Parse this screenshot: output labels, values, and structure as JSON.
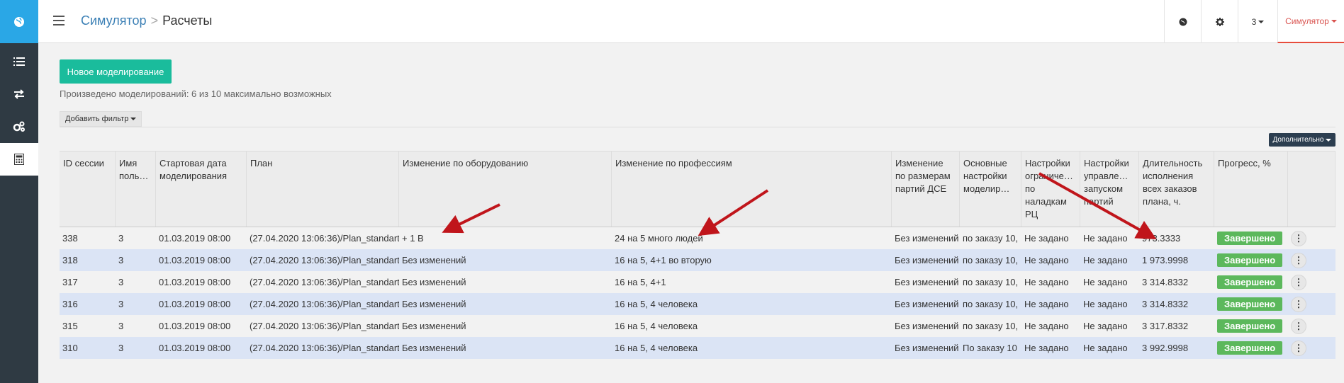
{
  "colors": {
    "sidebar": "#2f3a43",
    "accent": "#2aa7e6",
    "primary_btn": "#1abc9c",
    "success": "#5cb85c",
    "row_alt": "#dbe4f5",
    "annotation": "#c0151b"
  },
  "sidebar": {
    "items": [
      "globe-icon",
      "list-icon",
      "transfer-icon",
      "gears-icon",
      "calculator-icon"
    ]
  },
  "breadcrumb": {
    "parent": "Симулятор",
    "separator": ">",
    "current": "Расчеты"
  },
  "topbar": {
    "count": "3",
    "user": "Симулятор"
  },
  "toolbar": {
    "new_button": "Новое моделирование",
    "info": "Произведено моделирований: 6 из 10 максимально возможных",
    "filter_button": "Добавить фильтр",
    "more_button": "Дополнительно"
  },
  "table": {
    "headers": [
      "ID сессии",
      "Имя поль…",
      "Стартовая дата моделирования",
      "План",
      "Изменение по оборудованию",
      "Изменение по профессиям",
      "Изменение по размерам партий ДСЕ",
      "Основные настройки моделир…",
      "Настройки ограниче… по наладкам РЦ",
      "Настройки управле… запуском партий",
      "Длительность исполнения всех заказов плана, ч.",
      "Прогресс, %",
      ""
    ],
    "rows": [
      {
        "id": "338",
        "user": "3",
        "start": "01.03.2019 08:00",
        "plan": "(27.04.2020 13:06:36)/Plan_standart",
        "equip": "+ 1 В",
        "prof": "24 на 5 много людей",
        "batch": "Без изменений",
        "main": "по заказу 10,",
        "setup": "Не задано",
        "launch": "Не задано",
        "duration": "973.3333",
        "status": "Завершено"
      },
      {
        "id": "318",
        "user": "3",
        "start": "01.03.2019 08:00",
        "plan": "(27.04.2020 13:06:36)/Plan_standart",
        "equip": "Без изменений",
        "prof": "16 на 5, 4+1 во вторую",
        "batch": "Без изменений",
        "main": "по заказу 10,",
        "setup": "Не задано",
        "launch": "Не задано",
        "duration": "1 973.9998",
        "status": "Завершено"
      },
      {
        "id": "317",
        "user": "3",
        "start": "01.03.2019 08:00",
        "plan": "(27.04.2020 13:06:36)/Plan_standart",
        "equip": "Без изменений",
        "prof": "16 на 5, 4+1",
        "batch": "Без изменений",
        "main": "по заказу 10,",
        "setup": "Не задано",
        "launch": "Не задано",
        "duration": "3 314.8332",
        "status": "Завершено"
      },
      {
        "id": "316",
        "user": "3",
        "start": "01.03.2019 08:00",
        "plan": "(27.04.2020 13:06:36)/Plan_standart",
        "equip": "Без изменений",
        "prof": "16 на 5, 4 человека",
        "batch": "Без изменений",
        "main": "по заказу 10,",
        "setup": "Не задано",
        "launch": "Не задано",
        "duration": "3 314.8332",
        "status": "Завершено"
      },
      {
        "id": "315",
        "user": "3",
        "start": "01.03.2019 08:00",
        "plan": "(27.04.2020 13:06:36)/Plan_standart",
        "equip": "Без изменений",
        "prof": "16 на 5, 4 человека",
        "batch": "Без изменений",
        "main": "по заказу 10,",
        "setup": "Не задано",
        "launch": "Не задано",
        "duration": "3 317.8332",
        "status": "Завершено"
      },
      {
        "id": "310",
        "user": "3",
        "start": "01.03.2019 08:00",
        "plan": "(27.04.2020 13:06:36)/Plan_standart",
        "equip": "Без изменений",
        "prof": "16 на 5, 4 человека",
        "batch": "Без изменений",
        "main": "По заказу 10",
        "setup": "Не задано",
        "launch": "Не задано",
        "duration": "3 992.9998",
        "status": "Завершено"
      }
    ]
  }
}
